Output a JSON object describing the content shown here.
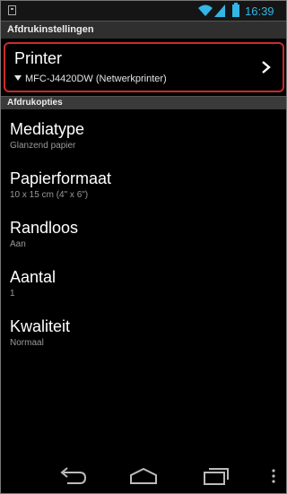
{
  "status_bar": {
    "time": "16:39",
    "accent_color": "#33b5e5"
  },
  "sections": {
    "print_settings": "Afdrukinstellingen",
    "print_options": "Afdrukopties"
  },
  "printer": {
    "title": "Printer",
    "device": "MFC-J4420DW (Netwerkprinter)",
    "highlight_color": "#cc2b2b"
  },
  "options": [
    {
      "title": "Mediatype",
      "value": "Glanzend papier"
    },
    {
      "title": "Papierformaat",
      "value": "10 x 15 cm (4\" x 6\")"
    },
    {
      "title": "Randloos",
      "value": "Aan"
    },
    {
      "title": "Aantal",
      "value": "1"
    },
    {
      "title": "Kwaliteit",
      "value": "Normaal"
    }
  ],
  "nav_icons": [
    "back-icon",
    "home-icon",
    "recents-icon",
    "overflow-menu-icon"
  ]
}
